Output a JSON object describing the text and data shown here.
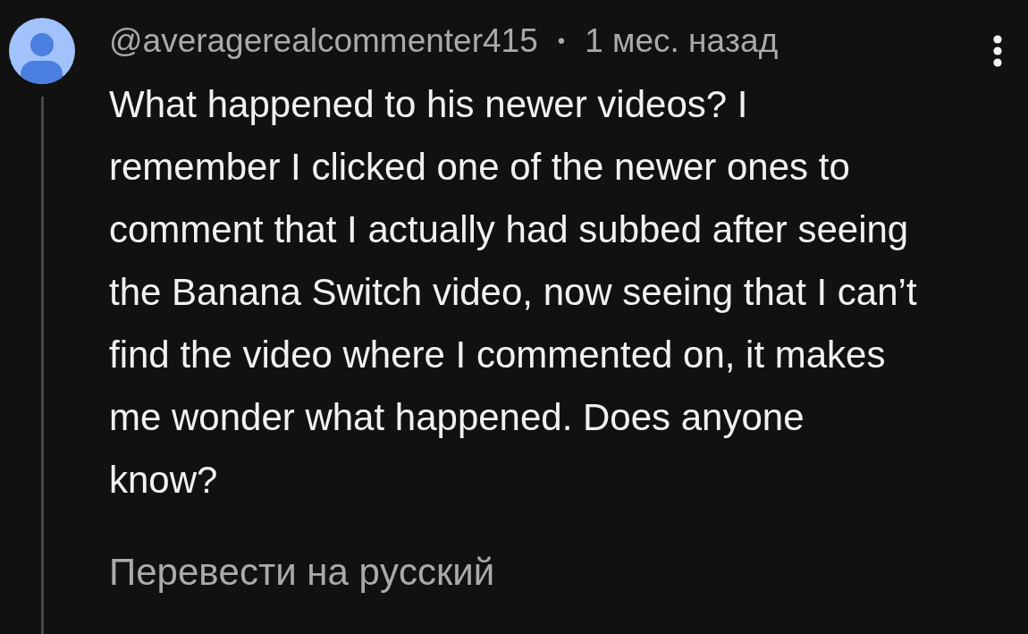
{
  "comment": {
    "author": "@averagerealcommenter415",
    "separator": "•",
    "posted": "1 мес. назад",
    "text": "What happened to his newer videos? I remember I clicked one of the newer ones to comment that I actually had subbed after seeing the Banana Switch video, now seeing that I can’t find the video where I commented on, it makes me wonder what happened. Does anyone know?",
    "translate_link": "Перевести на русский"
  }
}
